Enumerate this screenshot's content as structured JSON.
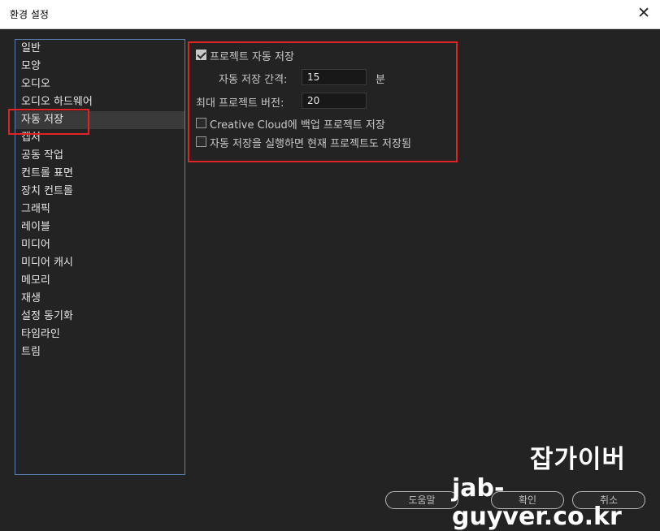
{
  "window": {
    "title": "환경 설정",
    "close_glyph": "✕"
  },
  "categories": [
    {
      "label": "일반"
    },
    {
      "label": "모양"
    },
    {
      "label": "오디오"
    },
    {
      "label": "오디오 하드웨어"
    },
    {
      "label": "자동 저장",
      "selected": true
    },
    {
      "label": "캡처"
    },
    {
      "label": "공동 작업"
    },
    {
      "label": "컨트롤 표면"
    },
    {
      "label": "장치 컨트롤"
    },
    {
      "label": "그래픽"
    },
    {
      "label": "레이블"
    },
    {
      "label": "미디어"
    },
    {
      "label": "미디어 캐시"
    },
    {
      "label": "메모리"
    },
    {
      "label": "재생"
    },
    {
      "label": "설정 동기화"
    },
    {
      "label": "타임라인"
    },
    {
      "label": "트림"
    }
  ],
  "autosave": {
    "autosave_projects_label": "프로젝트 자동 저장",
    "autosave_projects_checked": true,
    "interval_label": "자동 저장 간격:",
    "interval_value": "15",
    "interval_unit": "분",
    "max_versions_label": "최대 프로젝트 버전:",
    "max_versions_value": "20",
    "backup_cc_label": "Creative Cloud에 백업 프로젝트 저장",
    "backup_cc_checked": false,
    "save_current_label": "자동 저장을 실행하면 현재 프로젝트도 저장됨",
    "save_current_checked": false
  },
  "buttons": {
    "help_label": "도움말",
    "ok_label": "확인",
    "cancel_label": "취소"
  },
  "watermark": {
    "line1": "잡가이버",
    "line2": "jab-guyver.co.kr"
  },
  "colors": {
    "highlight_box": "#e02424",
    "list_border": "#5a7fb3",
    "background": "#232323"
  }
}
